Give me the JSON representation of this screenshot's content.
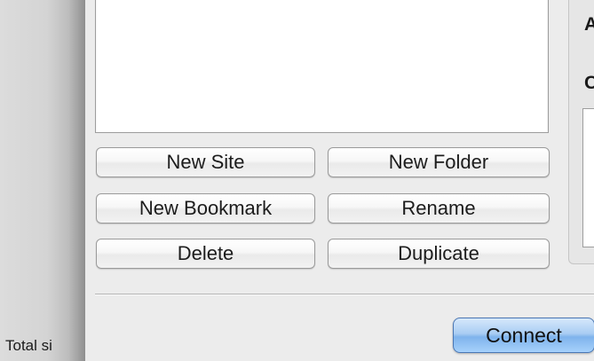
{
  "background_window": {
    "status_text": "Total si"
  },
  "site_manager": {
    "buttons": {
      "new_site": "New Site",
      "new_folder": "New Folder",
      "new_bookmark": "New Bookmark",
      "rename": "Rename",
      "delete": "Delete",
      "duplicate": "Duplicate"
    },
    "connect_label": "Connect",
    "right_panel": {
      "label_1": "A",
      "label_2": "C"
    }
  },
  "colors": {
    "connect_accent": "#8fbff0",
    "dialog_background": "#ececec"
  }
}
